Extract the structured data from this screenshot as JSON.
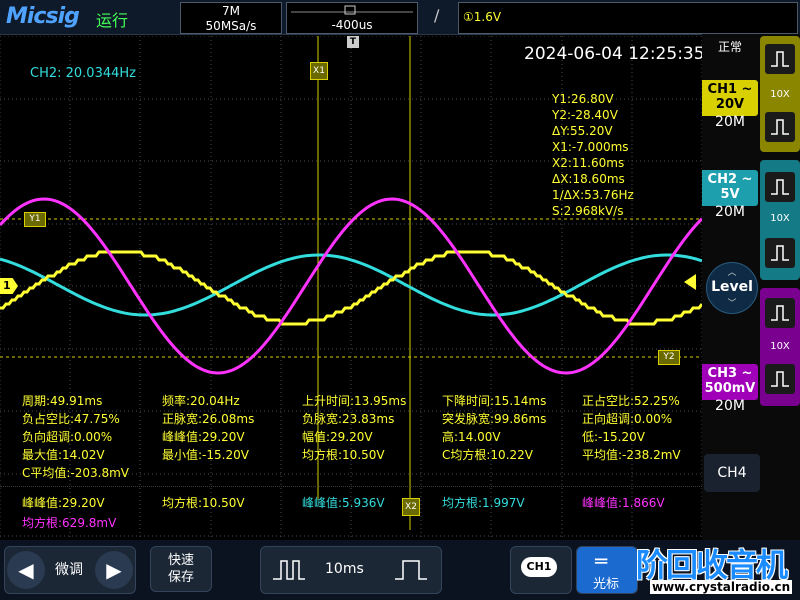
{
  "topbar": {
    "logo": "Micsig",
    "run_state": "运行",
    "memory_depth": "7M",
    "sample_rate": "50MSa/s",
    "time_position": "-400us",
    "trigger_slope_icon": "rising-edge-icon",
    "trigger_info": "①1.6V"
  },
  "screen": {
    "datetime": "2024-06-04 12:25:35",
    "frequency_readout": "CH2: 20.0344Hz",
    "trigger_marker": "T",
    "ch1_ground_marker": "1",
    "cursor_labels": {
      "x1": "X1",
      "x2": "X2",
      "y1": "Y1",
      "y2": "Y2"
    },
    "cursor_readouts": [
      "Y1:26.80V",
      "Y2:-28.40V",
      "ΔY:55.20V",
      "X1:-7.000ms",
      "X2:11.60ms",
      "ΔX:18.60ms",
      "1/ΔX:53.76Hz",
      "S:2.968kV/s"
    ]
  },
  "measurements": {
    "rows": [
      [
        "周期:49.91ms",
        "频率:20.04Hz",
        "上升时间:13.95ms",
        "下降时间:15.14ms",
        "正占空比:52.25%"
      ],
      [
        "负占空比:47.75%",
        "正脉宽:26.08ms",
        "负脉宽:23.83ms",
        "突发脉宽:99.86ms",
        "正向超调:0.00%"
      ],
      [
        "负向超调:0.00%",
        "峰峰值:29.20V",
        "幅值:29.20V",
        "高:14.00V",
        "低:-15.20V"
      ],
      [
        "最大值:14.02V",
        "最小值:-15.20V",
        "均方根:10.50V",
        "C均方根:10.22V",
        "平均值:-238.2mV"
      ],
      [
        "C平均值:-203.8mV"
      ]
    ],
    "summary": [
      {
        "text": "峰峰值:29.20V",
        "color": "#ffff33"
      },
      {
        "text": "均方根:10.50V",
        "color": "#ffff33"
      },
      {
        "text": "峰峰值:5.936V",
        "color": "#33dddd"
      },
      {
        "text": "均方根:1.997V",
        "color": "#33dddd"
      },
      {
        "text": "峰峰值:1.866V",
        "color": "#ff33ff"
      },
      {
        "text": "均方根:629.8mV",
        "color": "#ff33ff"
      }
    ]
  },
  "right_panel": {
    "mode": "正常",
    "ch1": {
      "name": "CH1 ~",
      "scale": "20V",
      "sub": "20M",
      "color": "#d8d000"
    },
    "ch2": {
      "name": "CH2 ~",
      "scale": "5V",
      "sub": "20M",
      "color": "#22b8c8"
    },
    "ch3": {
      "name": "CH3 ~",
      "scale": "500mV",
      "sub": "20M",
      "color": "#b000c0"
    },
    "ch4": {
      "name": "CH4"
    },
    "probe_ratio": "10X",
    "level_label": "Level"
  },
  "bottombar": {
    "fine_label": "微调",
    "quick_save": "快速\n保存",
    "timebase": "10ms",
    "ch_select": "CH1",
    "cursor_label": "光标",
    "watermark": "阶回收音机",
    "watermark_url": "www.crystalradio.cn"
  },
  "colors": {
    "ch1": "#ffff33",
    "ch2": "#33dddd",
    "ch3": "#ff33ff",
    "grid": "#4a4a4a",
    "accent": "#1a8cff"
  }
}
